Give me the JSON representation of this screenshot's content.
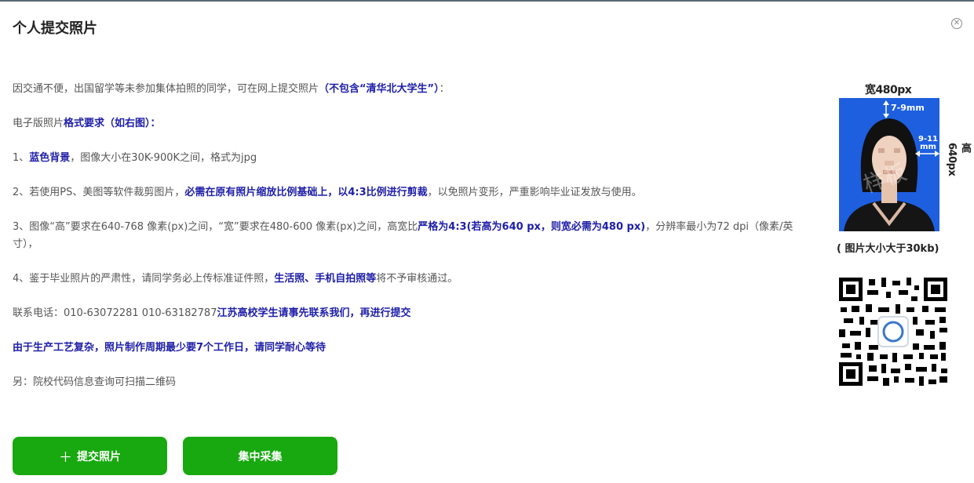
{
  "dialog": {
    "title": "个人提交照片",
    "close_icon": "close-circle-icon"
  },
  "content": {
    "line1": {
      "text": "因交通不便，出国留学等未参加集体拍照的同学，可在网上提交照片",
      "highlight": "（不包含“清华北大学生”）",
      "tail": "："
    },
    "line2": {
      "text": "电子版照片",
      "highlight": "格式要求（如右图）："
    },
    "line3": {
      "prefix": "1、",
      "highlight": "蓝色背景",
      "tail": "，图像大小在30K-900K之间，格式为jpg"
    },
    "line4": {
      "text": "2、若使用PS、美图等软件裁剪图片，",
      "highlight": "必需在原有照片缩放比例基础上，以4:3比例进行剪裁",
      "tail": "，以免照片变形，严重影响毕业证发放与使用。"
    },
    "line5": {
      "text": "3、图像“高”要求在640-768 像素(px)之间，“宽”要求在480-600 像素(px)之间，高宽比",
      "highlight": "严格为4:3(若高为640 px，则宽必需为480 px)",
      "tail": "，分辨率最小为72 dpi（像素/英寸），"
    },
    "line6": {
      "text": "4、鉴于毕业照片的严肃性，请同学务必上传标准证件照，",
      "highlight": "生活照、手机自拍照等",
      "tail": "将不予审核通过。"
    },
    "line7": {
      "text": "联系电话：010-63072281 010-63182787",
      "highlight": "江苏高校学生请事先联系我们，再进行提交"
    },
    "line8": {
      "highlight": "由于生产工艺复杂，照片制作周期最少要7个工作日，请同学耐心等待"
    },
    "line9": {
      "text": "另：院校代码信息查询可扫描二维码"
    }
  },
  "buttons": {
    "submit_icon": "plus-icon",
    "submit_label": "提交照片",
    "collect_label": "集中采集"
  },
  "sample_photo": {
    "width_label": "宽480px",
    "height_label": "高640px",
    "top_gap": "7-9mm",
    "side_gap": "9-11mm",
    "size_note": "( 图片大小大于30kb)",
    "background_color": "#1e5fe0"
  },
  "colors": {
    "accent_button": "#17a90f",
    "highlight_text": "#1e1ea8",
    "body_text": "#555555"
  }
}
